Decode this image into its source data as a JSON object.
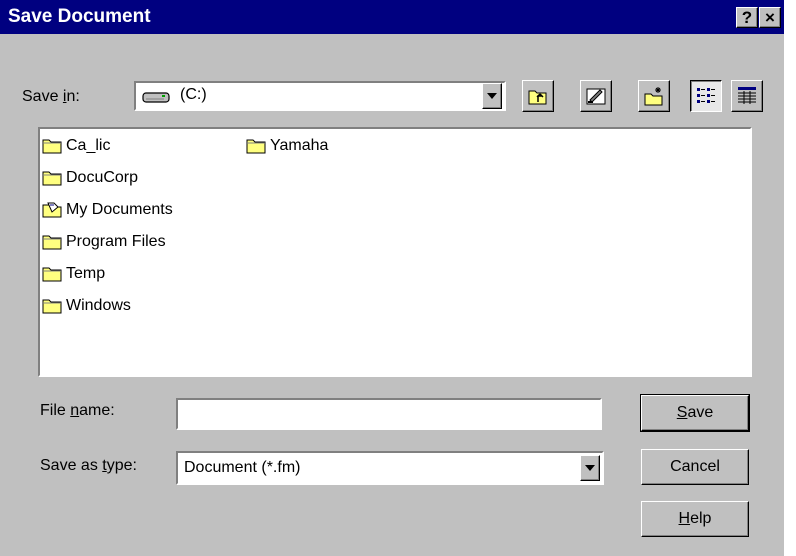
{
  "window": {
    "title": "Save Document",
    "help_glyph": "?",
    "close_glyph": "×"
  },
  "save_in": {
    "label_pre": "Save ",
    "label_accel": "i",
    "label_post": "n:",
    "value": "(C:)",
    "drive_icon": "hard-drive-icon"
  },
  "toolbar": {
    "icons": [
      "up-one-level-icon",
      "desktop-icon",
      "new-folder-icon",
      "list-view-icon",
      "details-view-icon"
    ]
  },
  "files": [
    {
      "name": "Ca_lic",
      "icon": "folder-icon"
    },
    {
      "name": "DocuCorp",
      "icon": "folder-icon"
    },
    {
      "name": "My Documents",
      "icon": "my-documents-icon"
    },
    {
      "name": "Program Files",
      "icon": "folder-icon"
    },
    {
      "name": "Temp",
      "icon": "folder-icon"
    },
    {
      "name": "Windows",
      "icon": "folder-icon"
    },
    {
      "name": "Yamaha",
      "icon": "folder-icon"
    }
  ],
  "file_name": {
    "label_pre": "File ",
    "label_accel": "n",
    "label_post": "ame:",
    "value": ""
  },
  "save_as_type": {
    "label_pre": "Save as ",
    "label_accel": "t",
    "label_post": "ype:",
    "value": "Document (*.fm)"
  },
  "buttons": {
    "save": {
      "accel": "S",
      "rest": "ave"
    },
    "cancel": {
      "label": "Cancel"
    },
    "help": {
      "accel": "H",
      "rest": "elp"
    }
  },
  "colors": {
    "titlebar": "#000080",
    "face": "#c0c0c0",
    "folder": "#ffff80"
  }
}
